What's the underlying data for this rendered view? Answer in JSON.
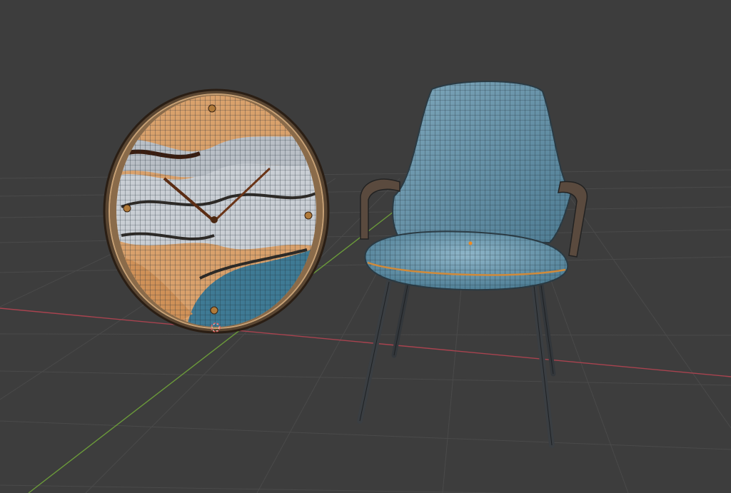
{
  "viewport": {
    "background": "#3d3d3d",
    "grid_color": "#4a4a4a",
    "x_axis_color": "#a8434f",
    "y_axis_color": "#6b9a3a"
  },
  "objects": [
    {
      "name": "wall-clock",
      "icon": "clock-mesh"
    },
    {
      "name": "armchair",
      "icon": "chair-mesh"
    }
  ],
  "origin": {
    "icon": "origin-marker"
  }
}
